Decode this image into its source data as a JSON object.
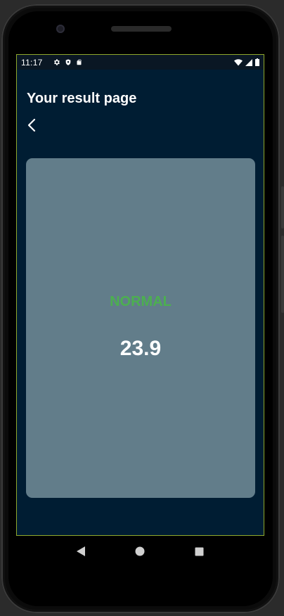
{
  "status_bar": {
    "time": "11:17",
    "left_icons": [
      "gear-icon",
      "shield-icon",
      "sd-card-icon"
    ],
    "right_icons": [
      "wifi-icon",
      "signal-icon",
      "battery-icon"
    ]
  },
  "header": {
    "title": "Your result page"
  },
  "result": {
    "status": "NORMAL",
    "value": "23.9"
  },
  "colors": {
    "background": "#001d33",
    "card": "#627d8a",
    "status_green": "#4caf50"
  },
  "nav": [
    "back-triangle-icon",
    "home-circle-icon",
    "recents-square-icon"
  ]
}
